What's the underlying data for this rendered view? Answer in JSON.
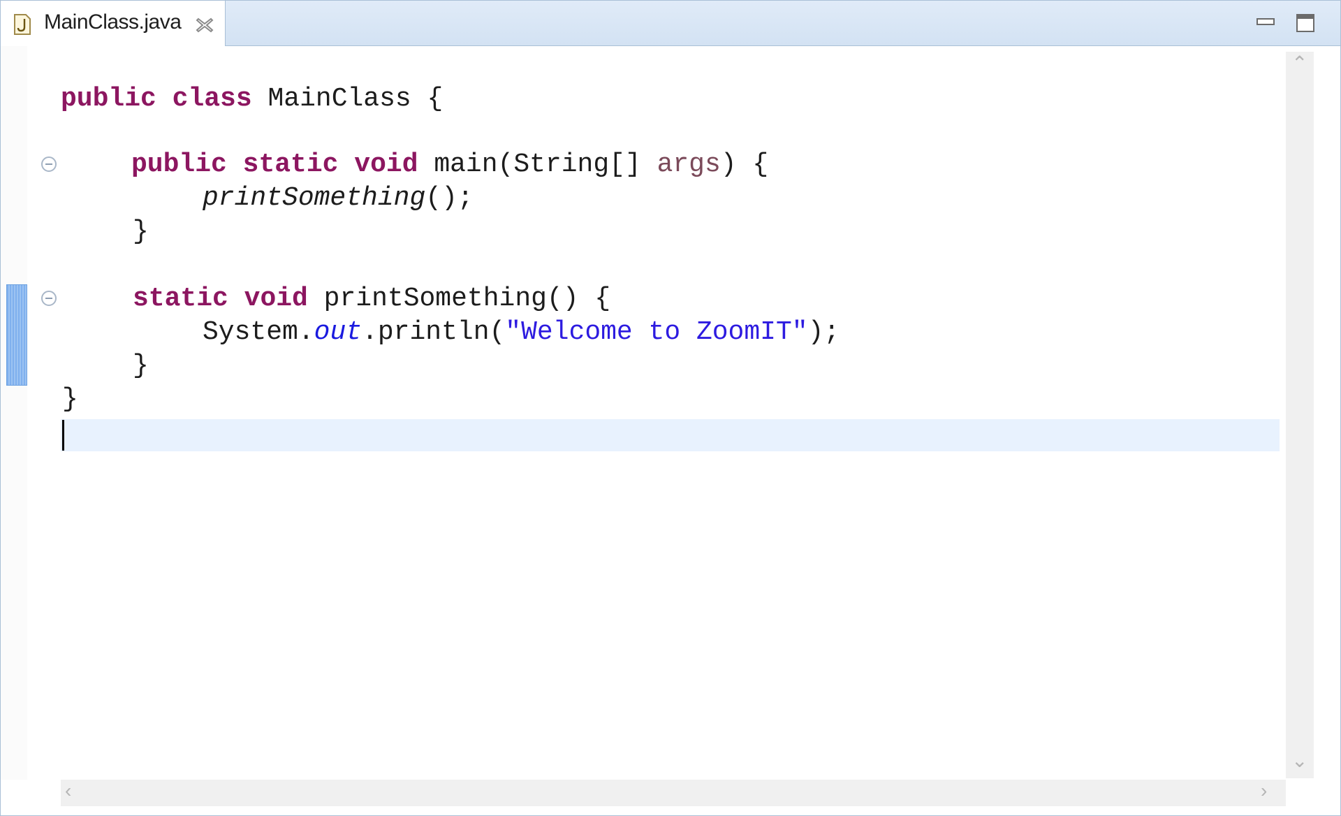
{
  "tab": {
    "icon": "java-file-icon",
    "label": "MainClass.java",
    "close_icon": "close-icon"
  },
  "window_controls": {
    "minimize_icon": "minimize-icon",
    "maximize_icon": "maximize-icon"
  },
  "code": {
    "l1_kw1": "public",
    "l1_kw2": "class",
    "l1_rest": "MainClass {",
    "l3_kw1": "public",
    "l3_kw2": "static",
    "l3_kw3": "void",
    "l3_mid": "main(String[]",
    "l3_param": "args",
    "l3_end": ") {",
    "l4_call": "printSomething",
    "l4_end": "();",
    "l5": "}",
    "l7_kw1": "static",
    "l7_kw2": "void",
    "l7_rest": "printSomething() {",
    "l8_start": "System.",
    "l8_field": "out",
    "l8_mid": ".println(",
    "l8_str": "\"Welcome to ZoomIT\"",
    "l8_end": ");",
    "l9": "}",
    "l10": "}"
  },
  "scrollbars": {
    "up_icon": "chevron-up-icon",
    "down_icon": "chevron-down-icon",
    "left_icon": "chevron-left-icon",
    "right_icon": "chevron-right-icon"
  },
  "colors": {
    "keyword": "#8c1660",
    "string": "#2d1be0",
    "static_field": "#1a1adf",
    "current_line": "#e8f2fe",
    "change_marker": "#7fb0ee"
  }
}
